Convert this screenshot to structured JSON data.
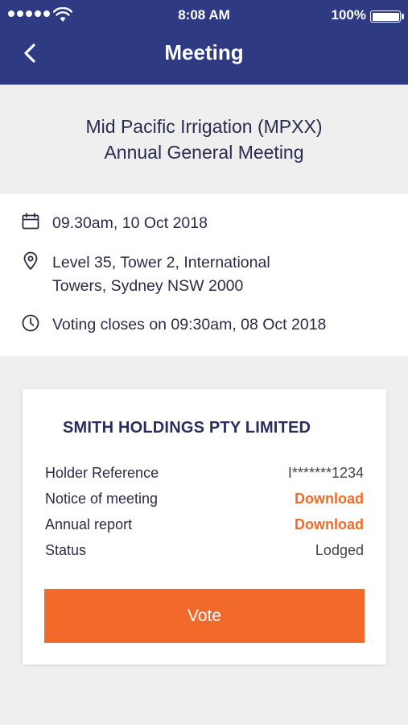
{
  "status_bar": {
    "time": "8:08 AM",
    "battery_percent": "100%"
  },
  "nav": {
    "title": "Meeting",
    "back_icon": "chevron-left-icon"
  },
  "meeting": {
    "title_line1": "Mid Pacific Irrigation (MPXX)",
    "title_line2": "Annual General Meeting"
  },
  "details": {
    "date": {
      "icon": "calendar-icon",
      "text": "09.30am, 10 Oct 2018"
    },
    "location": {
      "icon": "location-pin-icon",
      "line1": "Level 35, Tower 2, International",
      "line2": "Towers, Sydney NSW 2000"
    },
    "voting": {
      "icon": "clock-icon",
      "text": "Voting closes on 09:30am, 08 Oct 2018"
    }
  },
  "card": {
    "holder_name": "SMITH HOLDINGS PTY LIMITED",
    "rows": [
      {
        "label": "Holder Reference",
        "value": "I*******1234"
      },
      {
        "label": "Notice of meeting",
        "value": "Download"
      },
      {
        "label": "Annual report",
        "value": "Download"
      },
      {
        "label": "Status",
        "value": "Lodged"
      }
    ],
    "vote_label": "Vote"
  },
  "colors": {
    "header_bg": "#2e3a82",
    "accent": "#f26a2a",
    "page_bg": "#efefef",
    "text_dark": "#2b2b45"
  }
}
